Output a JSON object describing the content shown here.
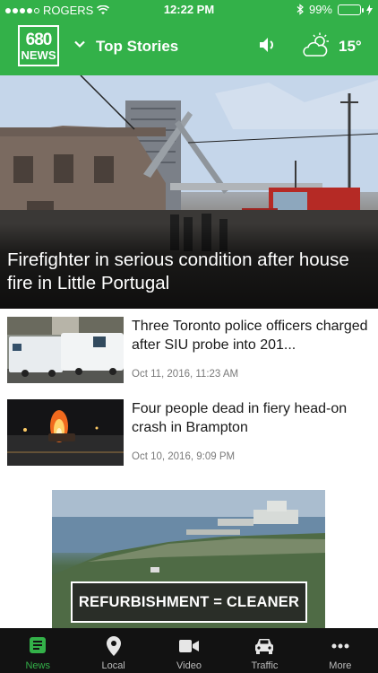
{
  "status_bar": {
    "carrier": "ROGERS",
    "time": "12:22 PM",
    "battery_percent": "99%",
    "battery_level": 0.99,
    "signal_bars_filled": 4,
    "signal_bars_total": 5
  },
  "app_bar": {
    "logo_line1": "680",
    "logo_line2": "NEWS",
    "section_title": "Top Stories",
    "temperature": "15°",
    "accent_color": "#33b149"
  },
  "hero": {
    "headline": "Firefighter in serious condition after house fire in Little Portugal"
  },
  "stories": [
    {
      "headline": "Three Toronto police officers charged after SIU probe into 201...",
      "date": "Oct 11, 2016, 11:23 AM"
    },
    {
      "headline": "Four people dead in fiery head-on crash in Brampton",
      "date": "Oct 10, 2016, 9:09 PM"
    }
  ],
  "ad": {
    "banner_text": "REFURBISHMENT = CLEANER AIR"
  },
  "tabs": [
    {
      "label": "News",
      "icon": "news-icon",
      "active": true
    },
    {
      "label": "Local",
      "icon": "location-pin-icon",
      "active": false
    },
    {
      "label": "Video",
      "icon": "video-camera-icon",
      "active": false
    },
    {
      "label": "Traffic",
      "icon": "car-icon",
      "active": false
    },
    {
      "label": "More",
      "icon": "more-dots-icon",
      "active": false
    }
  ]
}
